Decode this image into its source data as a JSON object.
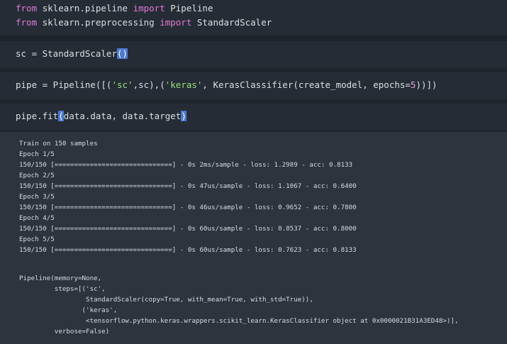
{
  "cells": [
    {
      "lines": [
        {
          "parts": [
            {
              "t": "from",
              "c": "kw"
            },
            {
              "t": " sklearn.pipeline ",
              "c": ""
            },
            {
              "t": "import",
              "c": "kw"
            },
            {
              "t": " Pipeline",
              "c": ""
            }
          ]
        },
        {
          "parts": [
            {
              "t": "from",
              "c": "kw"
            },
            {
              "t": " sklearn.preprocessing ",
              "c": ""
            },
            {
              "t": "import",
              "c": "kw"
            },
            {
              "t": " StandardScaler",
              "c": ""
            }
          ]
        }
      ]
    },
    {
      "lines": [
        {
          "parts": [
            {
              "t": "sc = StandardScaler",
              "c": ""
            },
            {
              "t": "()",
              "c": "hl"
            }
          ]
        }
      ]
    },
    {
      "lines": [
        {
          "parts": [
            {
              "t": "pipe = Pipeline([(",
              "c": ""
            },
            {
              "t": "'sc'",
              "c": "str"
            },
            {
              "t": ",sc),(",
              "c": ""
            },
            {
              "t": "'keras'",
              "c": "str"
            },
            {
              "t": ", KerasClassifier(create_model, epochs=",
              "c": ""
            },
            {
              "t": "5",
              "c": "num"
            },
            {
              "t": "))])",
              "c": ""
            }
          ]
        }
      ]
    },
    {
      "lines": [
        {
          "parts": [
            {
              "t": "pipe.fit",
              "c": ""
            },
            {
              "t": "(",
              "c": "hl"
            },
            {
              "t": "data.data, data.target",
              "c": ""
            },
            {
              "t": ")",
              "c": "hl"
            }
          ]
        }
      ]
    }
  ],
  "output": {
    "lines": [
      "Train on 150 samples",
      "Epoch 1/5",
      "150/150 [==============================] - 0s 2ms/sample - loss: 1.2989 - acc: 0.8133",
      "Epoch 2/5",
      "150/150 [==============================] - 0s 47us/sample - loss: 1.1067 - acc: 0.6400",
      "Epoch 3/5",
      "150/150 [==============================] - 0s 46us/sample - loss: 0.9652 - acc: 0.7800",
      "Epoch 4/5",
      "150/150 [==============================] - 0s 60us/sample - loss: 0.8537 - acc: 0.8000",
      "Epoch 5/5",
      "150/150 [==============================] - 0s 60us/sample - loss: 0.7623 - acc: 0.8133",
      "",
      "",
      "Pipeline(memory=None,",
      "         steps=[('sc',",
      "                 StandardScaler(copy=True, with_mean=True, with_std=True)),",
      "                ('keras',",
      "                 <tensorflow.python.keras.wrappers.scikit_learn.KerasClassifier object at 0x0000021B31A3ED48>)],",
      "         verbose=False)"
    ]
  }
}
